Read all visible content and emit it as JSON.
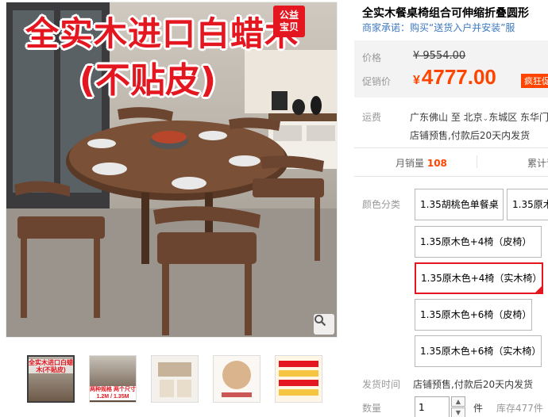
{
  "gallery": {
    "promo_line_1": "全实木进口白蜡木",
    "promo_line_2": "(不贴皮)",
    "badge_line_1": "公益",
    "badge_line_2": "宝贝",
    "thumbnails": [
      {
        "text": "全实木进口白蜡木(不贴皮)"
      },
      {
        "text": "1.2M / 1.35M",
        "subtext": "两种规格 两个尺寸"
      },
      {
        "text": ""
      },
      {
        "text": ""
      },
      {
        "text": ""
      }
    ]
  },
  "product": {
    "title": "全实木餐桌椅组合可伸缩折叠圆形",
    "subtitle": "商家承诺：购买“送货入户并安装”服"
  },
  "price": {
    "price_label": "价格",
    "original": "¥ 9554.00",
    "promo_label": "促销价",
    "yen": "¥",
    "promo_value": "4777.00",
    "flash_tag": "疯狂促"
  },
  "shipping": {
    "label": "运费",
    "line1_from": "广东佛山",
    "line1_to": "至 北京",
    "chevron": "⌄",
    "line1_rest": "东城区 东华门",
    "line2": "店铺预售,付款后20天内发货"
  },
  "stats": {
    "monthly_label": "月销量",
    "monthly_value": "108",
    "reviews_label": "累计评"
  },
  "sku": {
    "label": "颜色分类",
    "options": [
      "1.35胡桃色单餐桌",
      "1.35原木",
      "1.35原木色+4椅（皮椅）",
      "1.35原木色+4椅（实木椅）",
      "1.35原木色+6椅（皮椅）",
      "1.35原木色+6椅（实木椅）"
    ],
    "checkmark": "✓"
  },
  "delivery": {
    "label": "发货时间",
    "value": "店铺预售,付款后20天内发货"
  },
  "quantity": {
    "label": "数量",
    "value": "1",
    "unit": "件",
    "stock": "库存477件",
    "up": "▲",
    "down": "▼"
  },
  "colors": {
    "accent_red": "#e4161f",
    "price_orange": "#ff4400",
    "link_blue": "#3c78c0"
  }
}
